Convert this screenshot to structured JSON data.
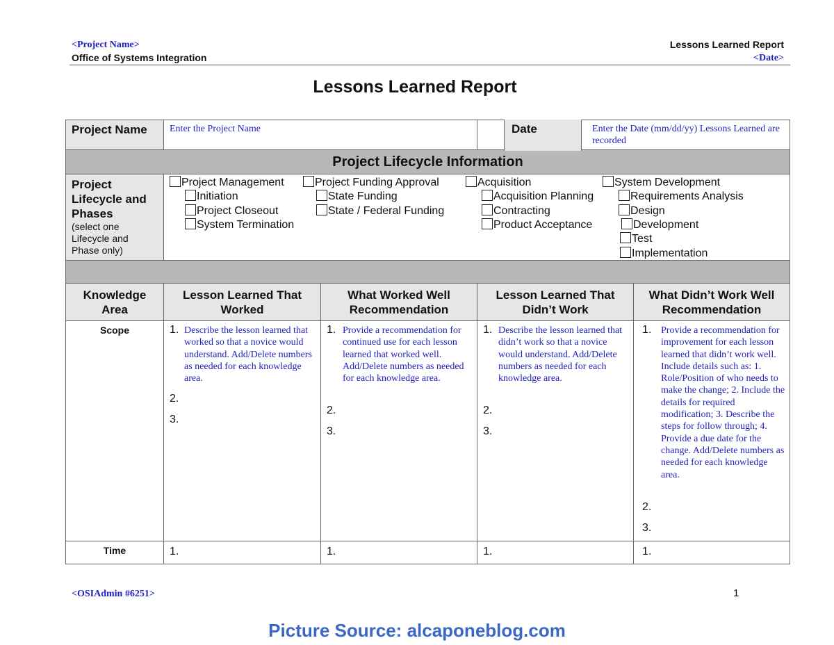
{
  "header": {
    "project_name_placeholder": "<Project Name>",
    "office": "Office of Systems Integration",
    "report_label": "Lessons Learned Report",
    "date_placeholder": "<Date>"
  },
  "title": "Lessons Learned Report",
  "project_info": {
    "project_name_label": "Project Name",
    "project_name_value": "Enter the Project Name",
    "date_label": "Date",
    "date_value": "Enter the Date (mm/dd/yy) Lessons Learned are recorded"
  },
  "lifecycle_section": {
    "heading": "Project Lifecycle Information",
    "label_main": "Project Lifecycle and Phases",
    "label_note": "(select one Lifecycle and Phase only)",
    "groups": [
      {
        "label": "Project Management",
        "checked": false,
        "phases": [
          {
            "label": "Initiation",
            "checked": false
          },
          {
            "label": "Project Closeout",
            "checked": false
          },
          {
            "label": "System Termination",
            "checked": false
          }
        ]
      },
      {
        "label": "Project Funding Approval",
        "checked": false,
        "phases": [
          {
            "label": "State Funding",
            "checked": false
          },
          {
            "label": "State / Federal Funding",
            "checked": false
          }
        ]
      },
      {
        "label": "Acquisition",
        "checked": false,
        "phases": [
          {
            "label": "Acquisition Planning",
            "checked": false
          },
          {
            "label": "Contracting",
            "checked": false
          },
          {
            "label": "Product Acceptance",
            "checked": false
          }
        ]
      },
      {
        "label": "System Development",
        "checked": false,
        "phases": [
          {
            "label": "Requirements Analysis",
            "checked": false
          },
          {
            "label": "Design",
            "checked": false
          },
          {
            "label": "Development",
            "checked": false
          },
          {
            "label": "Test",
            "checked": false
          },
          {
            "label": "Implementation",
            "checked": false
          }
        ]
      }
    ]
  },
  "lessons_table": {
    "columns": [
      "Knowledge Area",
      "Lesson Learned That Worked",
      "What Worked Well Recommendation",
      "Lesson Learned That Didn’t Work",
      "What Didn’t Work Well Recommendation"
    ],
    "rows": [
      {
        "area": "Scope",
        "cells": [
          {
            "items": [
              {
                "num": "1.",
                "text": "Describe the lesson learned that worked so that a novice would understand. Add/Delete numbers as needed for each knowledge area."
              },
              {
                "num": "2.",
                "text": ""
              },
              {
                "num": "3.",
                "text": ""
              }
            ]
          },
          {
            "items": [
              {
                "num": "1.",
                "text": "Provide a recommendation for continued use for each lesson learned that worked well. Add/Delete numbers as needed for each knowledge area."
              },
              {
                "num": "2.",
                "text": ""
              },
              {
                "num": "3.",
                "text": ""
              }
            ]
          },
          {
            "items": [
              {
                "num": "1.",
                "text": "Describe the lesson learned that didn’t work so that a novice would understand. Add/Delete numbers as needed for each knowledge area."
              },
              {
                "num": "2.",
                "text": ""
              },
              {
                "num": "3.",
                "text": ""
              }
            ]
          },
          {
            "items": [
              {
                "num": "1.",
                "text": "Provide a recommendation for improvement for each lesson learned that didn’t work well. Include details such as: 1. Role/Position of who needs to make the change; 2. Include the details for required modification; 3. Describe the steps for follow through; 4. Provide a due date for the change. Add/Delete numbers as needed for each knowledge area."
              },
              {
                "num": "2.",
                "text": ""
              },
              {
                "num": "3.",
                "text": ""
              }
            ]
          }
        ]
      },
      {
        "area": "Time",
        "cells": [
          {
            "items": [
              {
                "num": "1.",
                "text": ""
              }
            ]
          },
          {
            "items": [
              {
                "num": "1.",
                "text": ""
              }
            ]
          },
          {
            "items": [
              {
                "num": "1.",
                "text": ""
              }
            ]
          },
          {
            "items": [
              {
                "num": "1.",
                "text": ""
              }
            ]
          }
        ]
      }
    ]
  },
  "footer": {
    "doc_id": "<OSIAdmin #6251>",
    "page_number": "1"
  },
  "source_caption": "Picture Source: alcaponeblog.com"
}
